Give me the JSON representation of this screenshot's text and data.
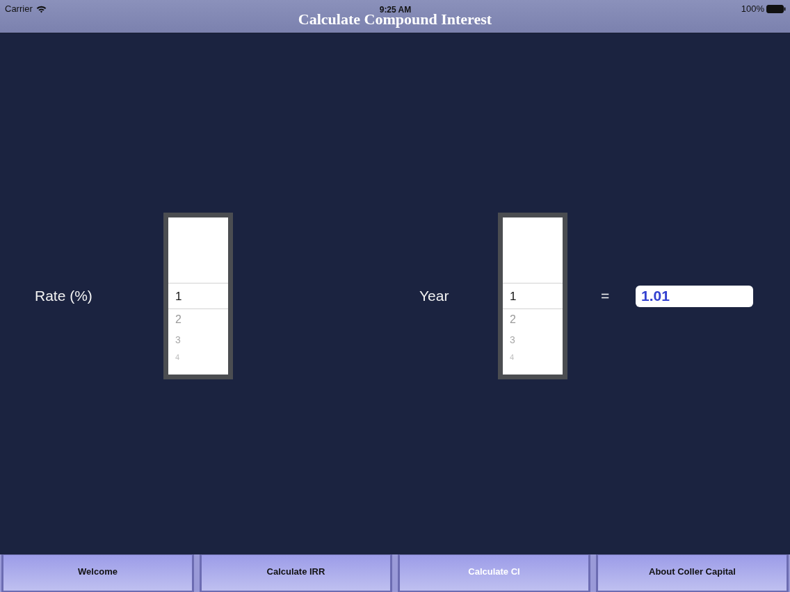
{
  "status_bar": {
    "carrier": "Carrier",
    "time": "9:25 AM",
    "battery": "100%"
  },
  "navigation_bar": {
    "title": "Calculate Compound Interest"
  },
  "calculator": {
    "rate": {
      "label": "Rate (%)",
      "picker": {
        "items": [
          {
            "label": "1",
            "selected": true
          },
          {
            "label": "2",
            "selected": false
          },
          {
            "label": "3",
            "selected": false
          },
          {
            "label": "4",
            "selected": false
          }
        ]
      }
    },
    "year": {
      "label": "Year",
      "picker": {
        "items": [
          {
            "label": "1",
            "selected": true
          },
          {
            "label": "2",
            "selected": false
          },
          {
            "label": "3",
            "selected": false
          },
          {
            "label": "4",
            "selected": false
          }
        ]
      }
    },
    "equals": "=",
    "result": {
      "value": "1.01"
    }
  },
  "tab_bar": {
    "tabs": [
      {
        "label": "Welcome",
        "selected": false
      },
      {
        "label": "Calculate IRR",
        "selected": false
      },
      {
        "label": "Calculate CI",
        "selected": true
      },
      {
        "label": "About Coller Capital",
        "selected": false
      }
    ]
  }
}
